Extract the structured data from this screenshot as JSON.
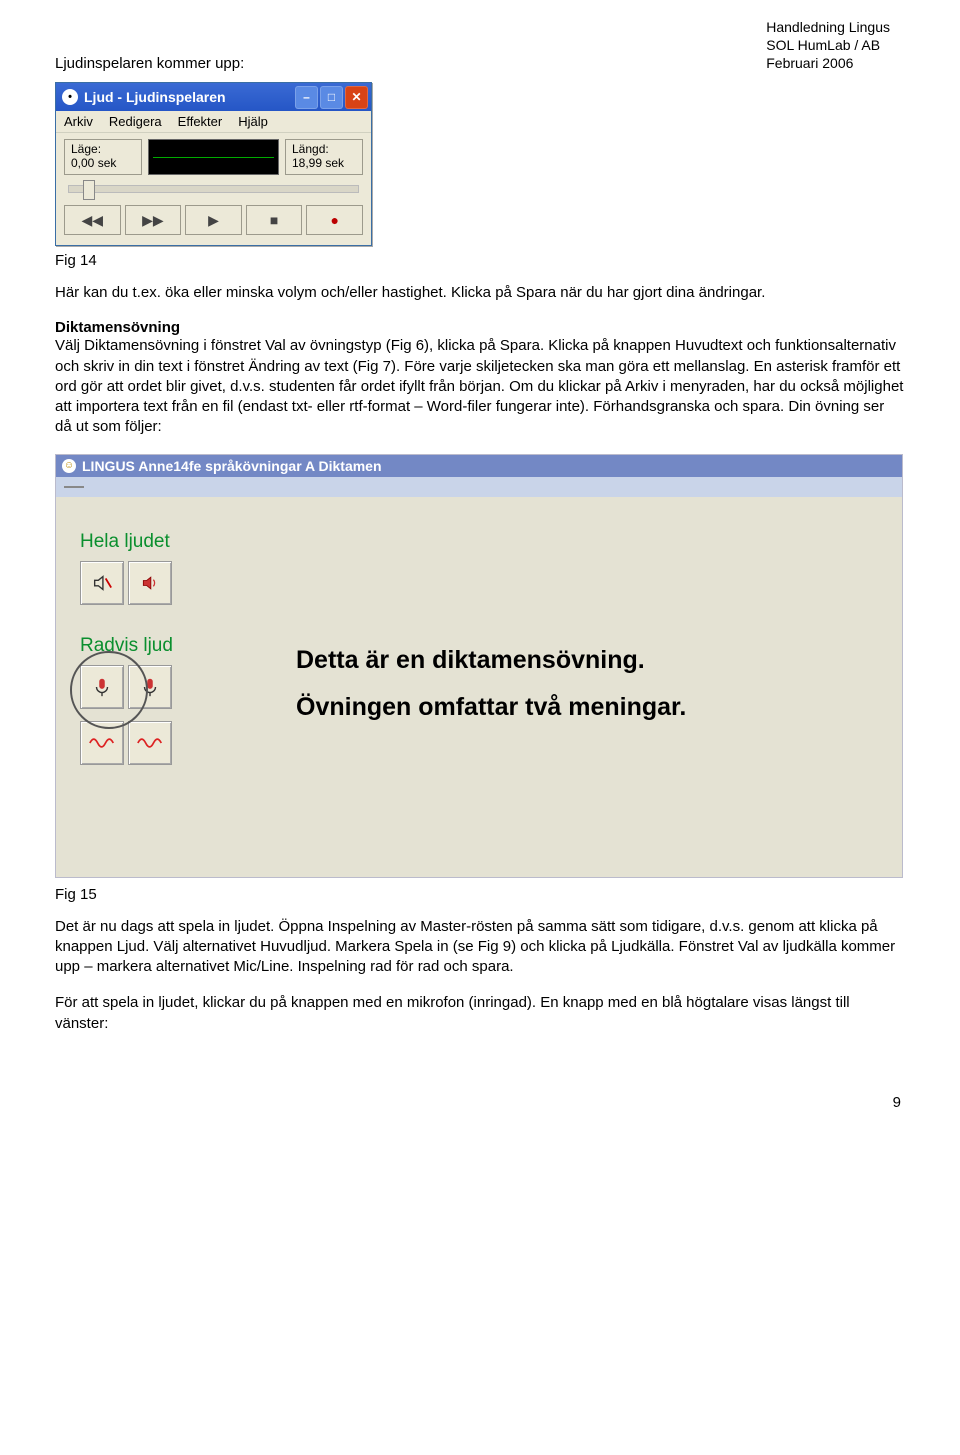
{
  "header": {
    "line1": "Handledning Lingus",
    "line2": "SOL HumLab / AB",
    "line3": "Februari 2006"
  },
  "intro": "Ljudinspelaren kommer upp:",
  "fig14": {
    "title": "Ljud - Ljudinspelaren",
    "menus": [
      "Arkiv",
      "Redigera",
      "Effekter",
      "Hjälp"
    ],
    "lage_label": "Läge:",
    "lage_value": "0,00 sek",
    "langd_label": "Längd:",
    "langd_value": "18,99 sek",
    "caption": "Fig 14"
  },
  "para1": "Här kan du t.ex. öka eller minska volym och/eller hastighet. Klicka på Spara när du har gjort dina ändringar.",
  "section_head": "Diktamensövning",
  "para2": "Välj Diktamensövning i fönstret Val av övningstyp (Fig 6), klicka på Spara. Klicka på knappen Huvudtext och funktionsalternativ och skriv in din text i fönstret Ändring av text (Fig 7). Före varje skiljetecken ska man göra ett mellanslag. En asterisk framför ett ord gör att ordet blir givet, d.v.s. studenten får ordet ifyllt från början. Om du klickar på Arkiv i menyraden, har du också möjlighet att importera text från en fil (endast txt- eller rtf-format – Word-filer fungerar inte). Förhandsgranska och spara. Din övning ser då ut som följer:",
  "fig15": {
    "title": "LINGUS Anne14fe språkövningar A Diktamen",
    "label_hela": "Hela ljudet",
    "label_radvis": "Radvis ljud",
    "line1": "Detta är en diktamensövning.",
    "line2": "Övningen omfattar två meningar.",
    "caption": "Fig 15"
  },
  "para3": "Det är nu dags att spela in ljudet. Öppna Inspelning av Master-rösten på samma sätt som tidigare, d.v.s. genom att klicka på knappen Ljud. Välj alternativet Huvudljud. Markera Spela in (se Fig 9) och klicka på Ljudkälla. Fönstret Val av ljudkälla kommer upp – markera alternativet Mic/Line. Inspelning rad för rad och spara.",
  "para4": "För att spela in ljudet, klickar du på knappen med en mikrofon (inringad). En knapp med en blå högtalare visas längst till vänster:",
  "page_number": "9"
}
